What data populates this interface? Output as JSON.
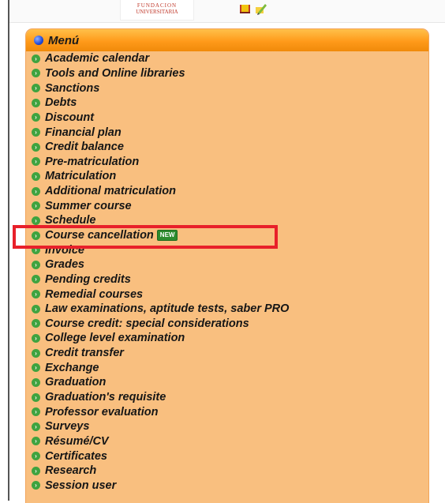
{
  "header": {
    "logo_line1": "FUNDACION",
    "logo_line2": "UNIVERSITARIA"
  },
  "menu": {
    "title": "Menú",
    "items": [
      {
        "label": "Academic calendar"
      },
      {
        "label": "Tools and Online libraries"
      },
      {
        "label": "Sanctions"
      },
      {
        "label": "Debts"
      },
      {
        "label": "Discount"
      },
      {
        "label": "Financial plan"
      },
      {
        "label": "Credit balance"
      },
      {
        "label": "Pre-matriculation"
      },
      {
        "label": "Matriculation"
      },
      {
        "label": "Additional matriculation"
      },
      {
        "label": "Summer course"
      },
      {
        "label": "Schedule"
      },
      {
        "label": "Course cancellation",
        "badge": "NEW"
      },
      {
        "label": "Invoice"
      },
      {
        "label": "Grades"
      },
      {
        "label": "Pending credits"
      },
      {
        "label": "Remedial courses"
      },
      {
        "label": "Law examinations, aptitude tests, saber PRO"
      },
      {
        "label": "Course credit: special considerations"
      },
      {
        "label": "College level examination"
      },
      {
        "label": "Credit transfer"
      },
      {
        "label": "Exchange"
      },
      {
        "label": "Graduation"
      },
      {
        "label": "Graduation's requisite"
      },
      {
        "label": "Professor evaluation"
      },
      {
        "label": "Surveys"
      },
      {
        "label": "Résumé/CV"
      },
      {
        "label": "Certificates"
      },
      {
        "label": "Research"
      },
      {
        "label": "Session user"
      }
    ]
  },
  "colors": {
    "menu_background": "#f9bf7f",
    "menu_header": "#ff9a1a",
    "bullet_green": "#3fa33f",
    "highlight_red": "#e8202a"
  },
  "icons": [
    "book-icon",
    "pencil-icon",
    "blue-bullet-icon",
    "green-bullet-icon"
  ]
}
